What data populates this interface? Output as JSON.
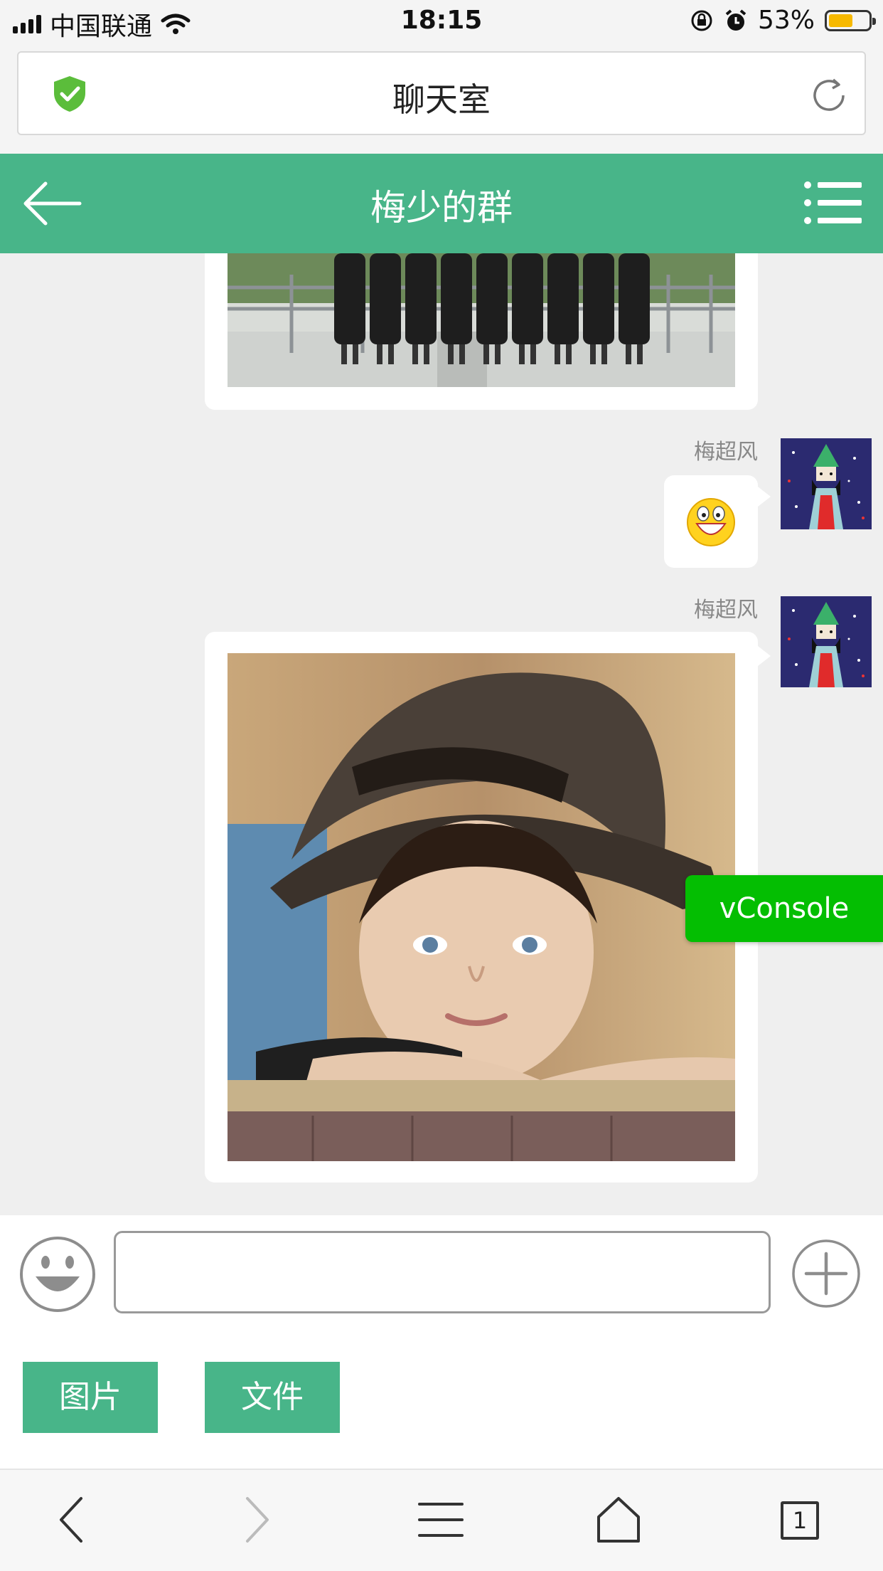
{
  "status_bar": {
    "carrier": "中国联通",
    "time": "18:15",
    "battery_percent": "53%",
    "battery_level": 0.53,
    "battery_color": "#f7b900"
  },
  "browser": {
    "page_title": "聊天室",
    "secure_icon": "shield-check-icon",
    "reload_icon": "reload-icon"
  },
  "header": {
    "title": "梅少的群",
    "back_icon": "arrow-left-icon",
    "menu_icon": "list-menu-icon",
    "color": "#48b589"
  },
  "messages": [
    {
      "type": "image",
      "description_icon": "group-photo",
      "partial": true
    },
    {
      "sender": "梅超风",
      "type": "emoji",
      "emoji_icon": "smiley-emoji-icon"
    },
    {
      "sender": "梅超风",
      "type": "image",
      "description_icon": "boy-with-hat-photo"
    }
  ],
  "input": {
    "value": "",
    "placeholder": "",
    "emoji_icon": "smiley-face-icon",
    "plus_icon": "plus-circle-icon"
  },
  "actions": {
    "image_label": "图片",
    "file_label": "文件"
  },
  "vconsole": {
    "label": "vConsole",
    "color": "#04be02"
  },
  "toolbar": {
    "back_icon": "chevron-left-icon",
    "forward_icon": "chevron-right-icon",
    "menu_icon": "hamburger-icon",
    "home_icon": "home-icon",
    "tabs_count": "1"
  }
}
